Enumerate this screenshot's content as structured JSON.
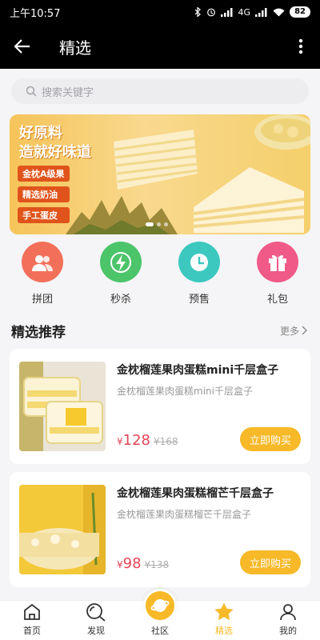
{
  "status_bar": {
    "time": "上午10:57",
    "network": "4G",
    "battery": "82"
  },
  "app_bar": {
    "title": "精选"
  },
  "search": {
    "placeholder": "搜索关键字"
  },
  "banner": {
    "headline_line1": "好原料",
    "headline_line2": "造就好味道",
    "tags": [
      "金枕A级果",
      "精选奶油",
      "手工蛋皮"
    ]
  },
  "categories": [
    {
      "label": "拼团",
      "icon": "group-icon",
      "color": "#f2705a"
    },
    {
      "label": "秒杀",
      "icon": "lightning-icon",
      "color": "#4cc46a"
    },
    {
      "label": "预售",
      "icon": "clock-icon",
      "color": "#3cc8bf"
    },
    {
      "label": "礼包",
      "icon": "gift-icon",
      "color": "#f05a88"
    }
  ],
  "section": {
    "title": "精选推荐",
    "more": "更多"
  },
  "products": [
    {
      "title": "金枕榴莲果肉蛋糕mini千层盒子",
      "subtitle": "金枕榴莲果肉蛋糕mini千层盒子",
      "currency": "¥",
      "price": "128",
      "original_price": "¥168",
      "buy_label": "立即购买"
    },
    {
      "title": "金枕榴莲果肉蛋糕榴芒千层盒子",
      "subtitle": "金枕榴莲果肉蛋糕榴芒千层盒子",
      "currency": "¥",
      "price": "98",
      "original_price": "¥138",
      "buy_label": "立即购买"
    }
  ],
  "bottom_nav": [
    {
      "label": "首页",
      "icon": "home-icon"
    },
    {
      "label": "发现",
      "icon": "discover-icon"
    },
    {
      "label": "社区",
      "icon": "community-icon"
    },
    {
      "label": "精选",
      "icon": "star-icon",
      "active": true
    },
    {
      "label": "我的",
      "icon": "profile-icon"
    }
  ],
  "colors": {
    "accent": "#f7b928",
    "price": "#e5465a",
    "app_bar": "#000000"
  }
}
